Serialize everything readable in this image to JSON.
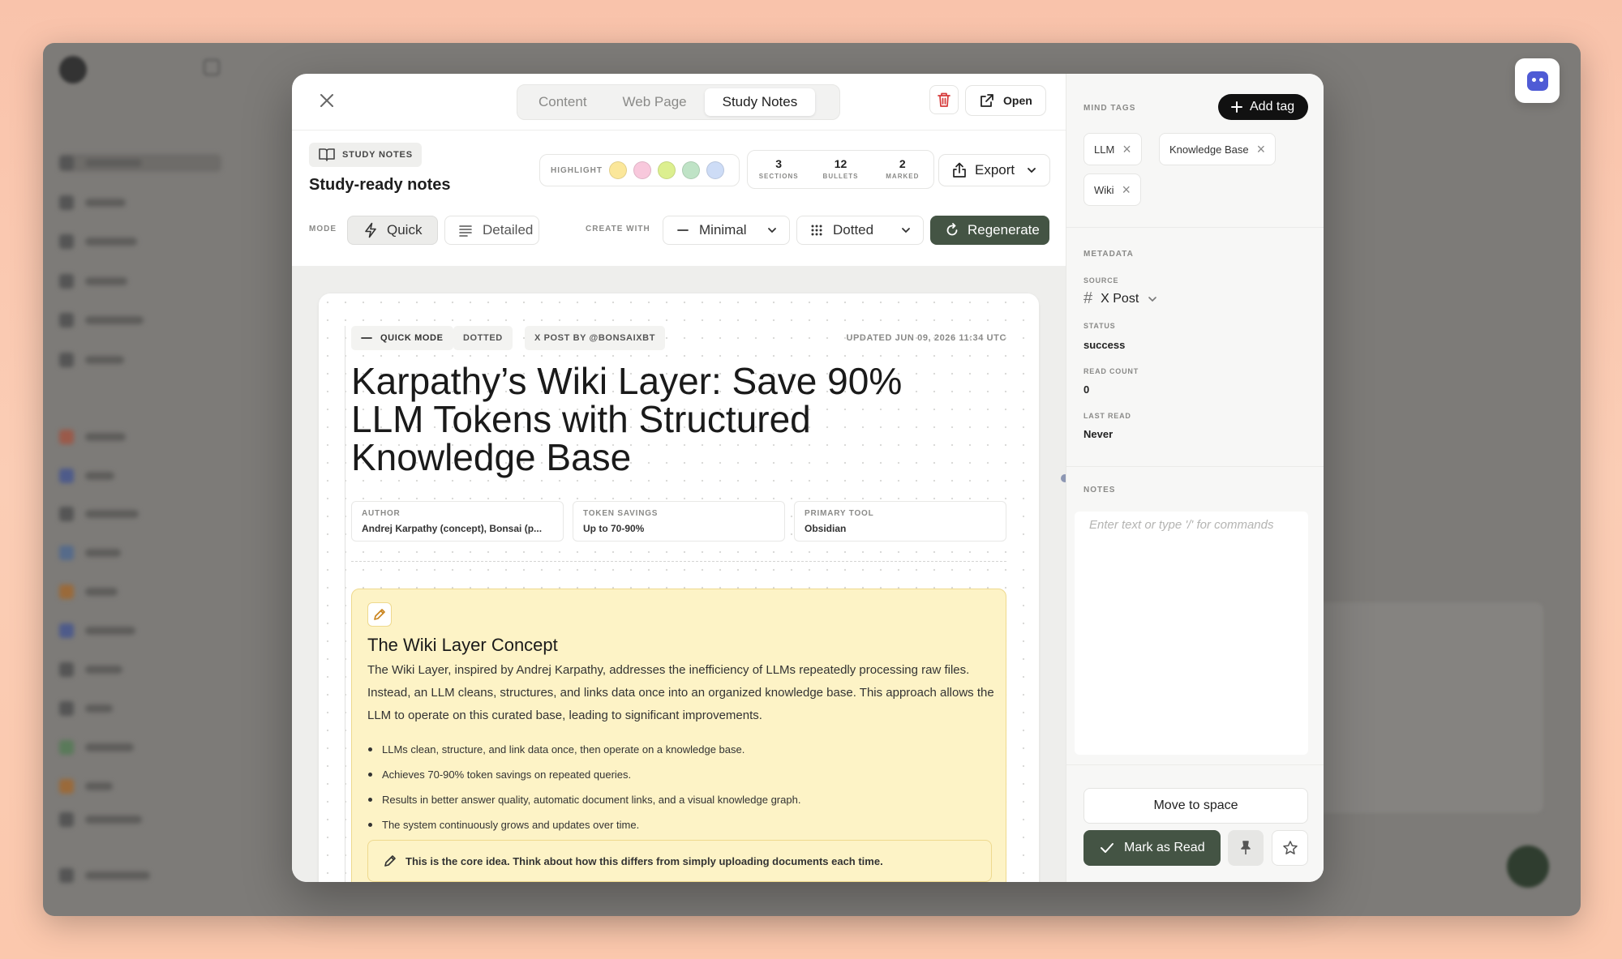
{
  "modal": {
    "tabs": [
      {
        "label": "Content",
        "active": false
      },
      {
        "label": "Web Page",
        "active": false
      },
      {
        "label": "Study Notes",
        "active": true
      }
    ],
    "open_label": "Open",
    "study_notes_badge": "STUDY NOTES",
    "header_title": "Study-ready notes",
    "highlight_label": "HIGHLIGHT",
    "highlight_colors": [
      "#fbe79a",
      "#f8c8dc",
      "#dcef8f",
      "#bfe3c6",
      "#cddcf6"
    ],
    "stats": [
      {
        "value": "3",
        "label": "SECTIONS"
      },
      {
        "value": "12",
        "label": "BULLETS"
      },
      {
        "value": "2",
        "label": "MARKED"
      }
    ],
    "export_label": "Export",
    "mode_label": "MODE",
    "mode_quick": "Quick",
    "mode_detailed": "Detailed",
    "create_with_label": "CREATE WITH",
    "style_select": "Minimal",
    "pattern_select": "Dotted",
    "regenerate_label": "Regenerate"
  },
  "doc": {
    "chips": [
      "QUICK MODE",
      "DOTTED",
      "X POST BY @BONSAIXBT"
    ],
    "updated": "UPDATED JUN 09, 2026 11:34 UTC",
    "title": "Karpathy’s Wiki Layer: Save 90% LLM Tokens with Structured Knowledge Base",
    "meta": [
      {
        "key": "AUTHOR",
        "value": "Andrej Karpathy (concept), Bonsai (p..."
      },
      {
        "key": "TOKEN SAVINGS",
        "value": "Up to 70-90%"
      },
      {
        "key": "PRIMARY TOOL",
        "value": "Obsidian"
      }
    ],
    "section": {
      "title": "The Wiki Layer Concept",
      "body": "The Wiki Layer, inspired by Andrej Karpathy, addresses the inefficiency of LLMs repeatedly processing raw files. Instead, an LLM cleans, structures, and links data once into an organized knowledge base. This approach allows the LLM to operate on this curated base, leading to significant improvements.",
      "bullets": [
        "LLMs clean, structure, and link data once, then operate on a knowledge base.",
        "Achieves 70-90% token savings on repeated queries.",
        "Results in better answer quality, automatic document links, and a visual knowledge graph.",
        "The system continuously grows and updates over time."
      ],
      "tip": "This is the core idea. Think about how this differs from simply uploading documents each time."
    }
  },
  "sidebar": {
    "mind_tags_label": "MIND TAGS",
    "add_tag_label": "Add tag",
    "tags": [
      "LLM",
      "Knowledge Base",
      "Wiki"
    ],
    "metadata_label": "METADATA",
    "source_label": "SOURCE",
    "source_value": "X Post",
    "status_label": "STATUS",
    "status_value": "success",
    "read_count_label": "READ COUNT",
    "read_count_value": "0",
    "last_read_label": "LAST READ",
    "last_read_value": "Never",
    "notes_label": "NOTES",
    "notes_placeholder": "Enter text or type '/' for commands",
    "move_label": "Move to space",
    "mark_read_label": "Mark as Read"
  },
  "colors": {
    "accent_green": "#445444",
    "concept_card_bg": "#fdf3c6",
    "delete_red": "#d63a3a",
    "bot_purple": "#4f5bd5"
  }
}
